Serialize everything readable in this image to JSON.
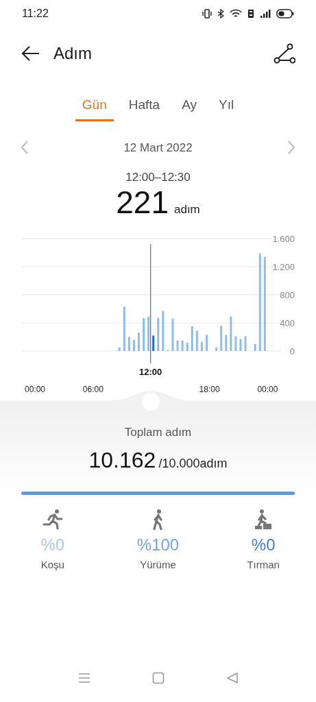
{
  "status_bar": {
    "time": "11:22"
  },
  "header": {
    "title": "Adım"
  },
  "tabs": [
    {
      "label": "Gün",
      "selected": true
    },
    {
      "label": "Hafta",
      "selected": false
    },
    {
      "label": "Ay",
      "selected": false
    },
    {
      "label": "Yıl",
      "selected": false
    }
  ],
  "date_nav": {
    "date": "12 Mart 2022"
  },
  "selection": {
    "range": "12:00–12:30",
    "value": "221",
    "unit": "adım"
  },
  "chart": {
    "chart_data": {
      "type": "bar",
      "x": [
        8.5,
        9,
        9.5,
        10,
        10.5,
        11,
        11.5,
        12,
        12.5,
        13,
        13.5,
        14,
        14.5,
        15,
        15.5,
        16,
        16.5,
        17,
        17.5,
        18.5,
        19,
        19.5,
        20,
        20.5,
        21,
        21.5,
        22.5,
        23,
        23.5
      ],
      "values": [
        50,
        630,
        200,
        160,
        260,
        470,
        490,
        220,
        470,
        570,
        10,
        460,
        150,
        150,
        120,
        350,
        290,
        130,
        230,
        50,
        360,
        230,
        490,
        210,
        170,
        210,
        100,
        1390,
        1340
      ],
      "xlim": [
        0,
        24
      ],
      "ylim": [
        0,
        1600
      ],
      "grid": true,
      "yticks": [
        {
          "value": 0,
          "label": "0"
        },
        {
          "value": 400,
          "label": "400"
        },
        {
          "value": 800,
          "label": "800"
        },
        {
          "value": 1200,
          "label": "1.200"
        },
        {
          "value": 1600,
          "label": "1.600"
        }
      ],
      "xticks": [
        {
          "value": 0,
          "label": "00:00"
        },
        {
          "value": 6,
          "label": "06:00"
        },
        {
          "value": 18,
          "label": "18:00"
        },
        {
          "value": 24,
          "label": "00:00"
        }
      ],
      "annotations": [
        {
          "x": 12,
          "text": "12:00"
        }
      ]
    }
  },
  "total": {
    "label": "Toplam adım",
    "value": "10.162",
    "goal": "/10.000adım",
    "level": 1
  },
  "activities": [
    {
      "kind": "run",
      "percent": "%0",
      "label": "Koşu",
      "color": "#a9c9ee"
    },
    {
      "kind": "walk",
      "percent": "%100",
      "label": "Yürüme",
      "color": "#6fa6e6"
    },
    {
      "kind": "climb",
      "percent": "%0",
      "label": "Tırman",
      "color": "#3d7fd6"
    }
  ]
}
